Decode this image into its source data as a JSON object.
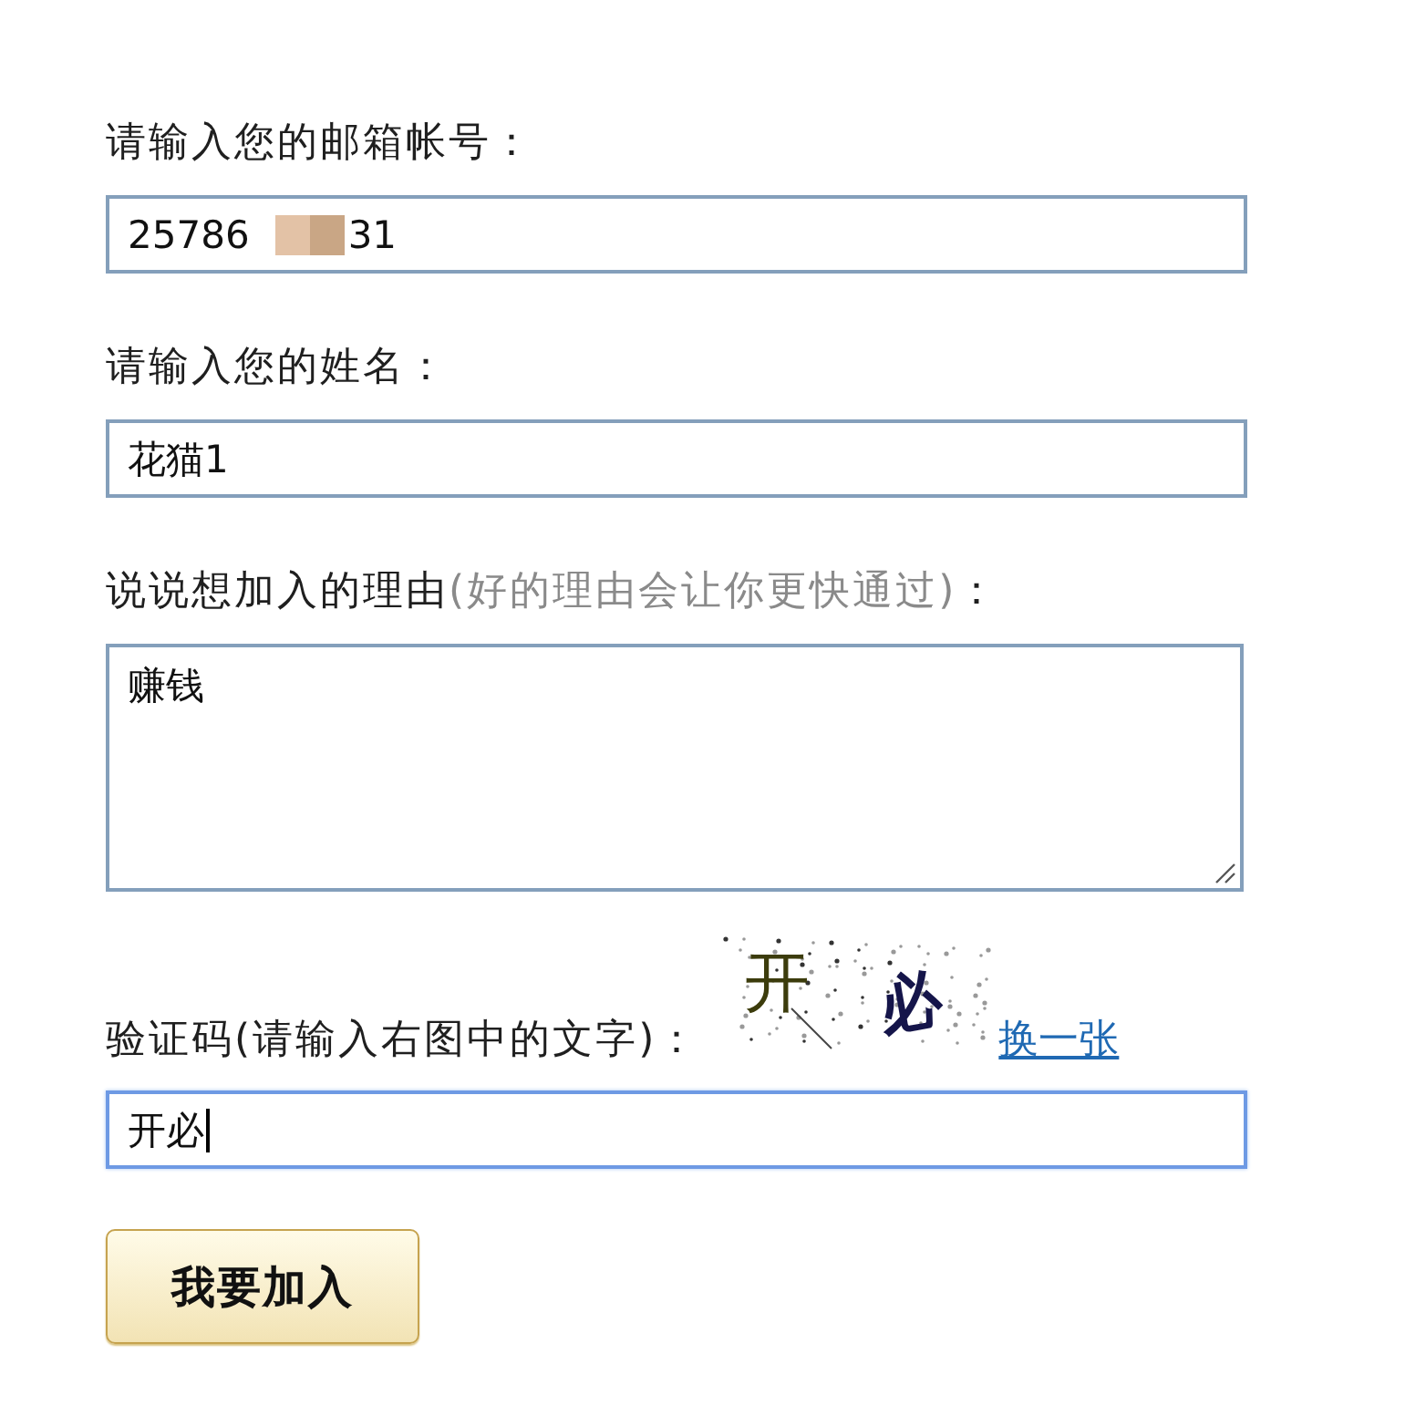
{
  "form": {
    "fields": [
      {
        "kind": "input",
        "label_parts": [
          {
            "text": "请输入您的邮箱帐号：",
            "muted": false
          }
        ],
        "value": "25786",
        "value_after_redaction": "31",
        "focused": false
      },
      {
        "kind": "input",
        "label_parts": [
          {
            "text": "请输入您的姓名：",
            "muted": false
          }
        ],
        "value": "花猫1",
        "focused": false
      },
      {
        "kind": "textarea",
        "label_parts": [
          {
            "text": "说说想加入的理由",
            "muted": false
          },
          {
            "text": "(好的理由会让你更快通过)",
            "muted": true
          },
          {
            "text": "：",
            "muted": false
          }
        ],
        "value": "赚钱",
        "focused": false
      },
      {
        "kind": "captcha",
        "label_parts": [
          {
            "text": "验证码(请输入右图中的文字)：",
            "muted": false
          }
        ],
        "captcha_text": "开必",
        "refresh_link": "换一张",
        "value": "开必",
        "focused": true
      }
    ],
    "submit_button": "我要加入"
  }
}
